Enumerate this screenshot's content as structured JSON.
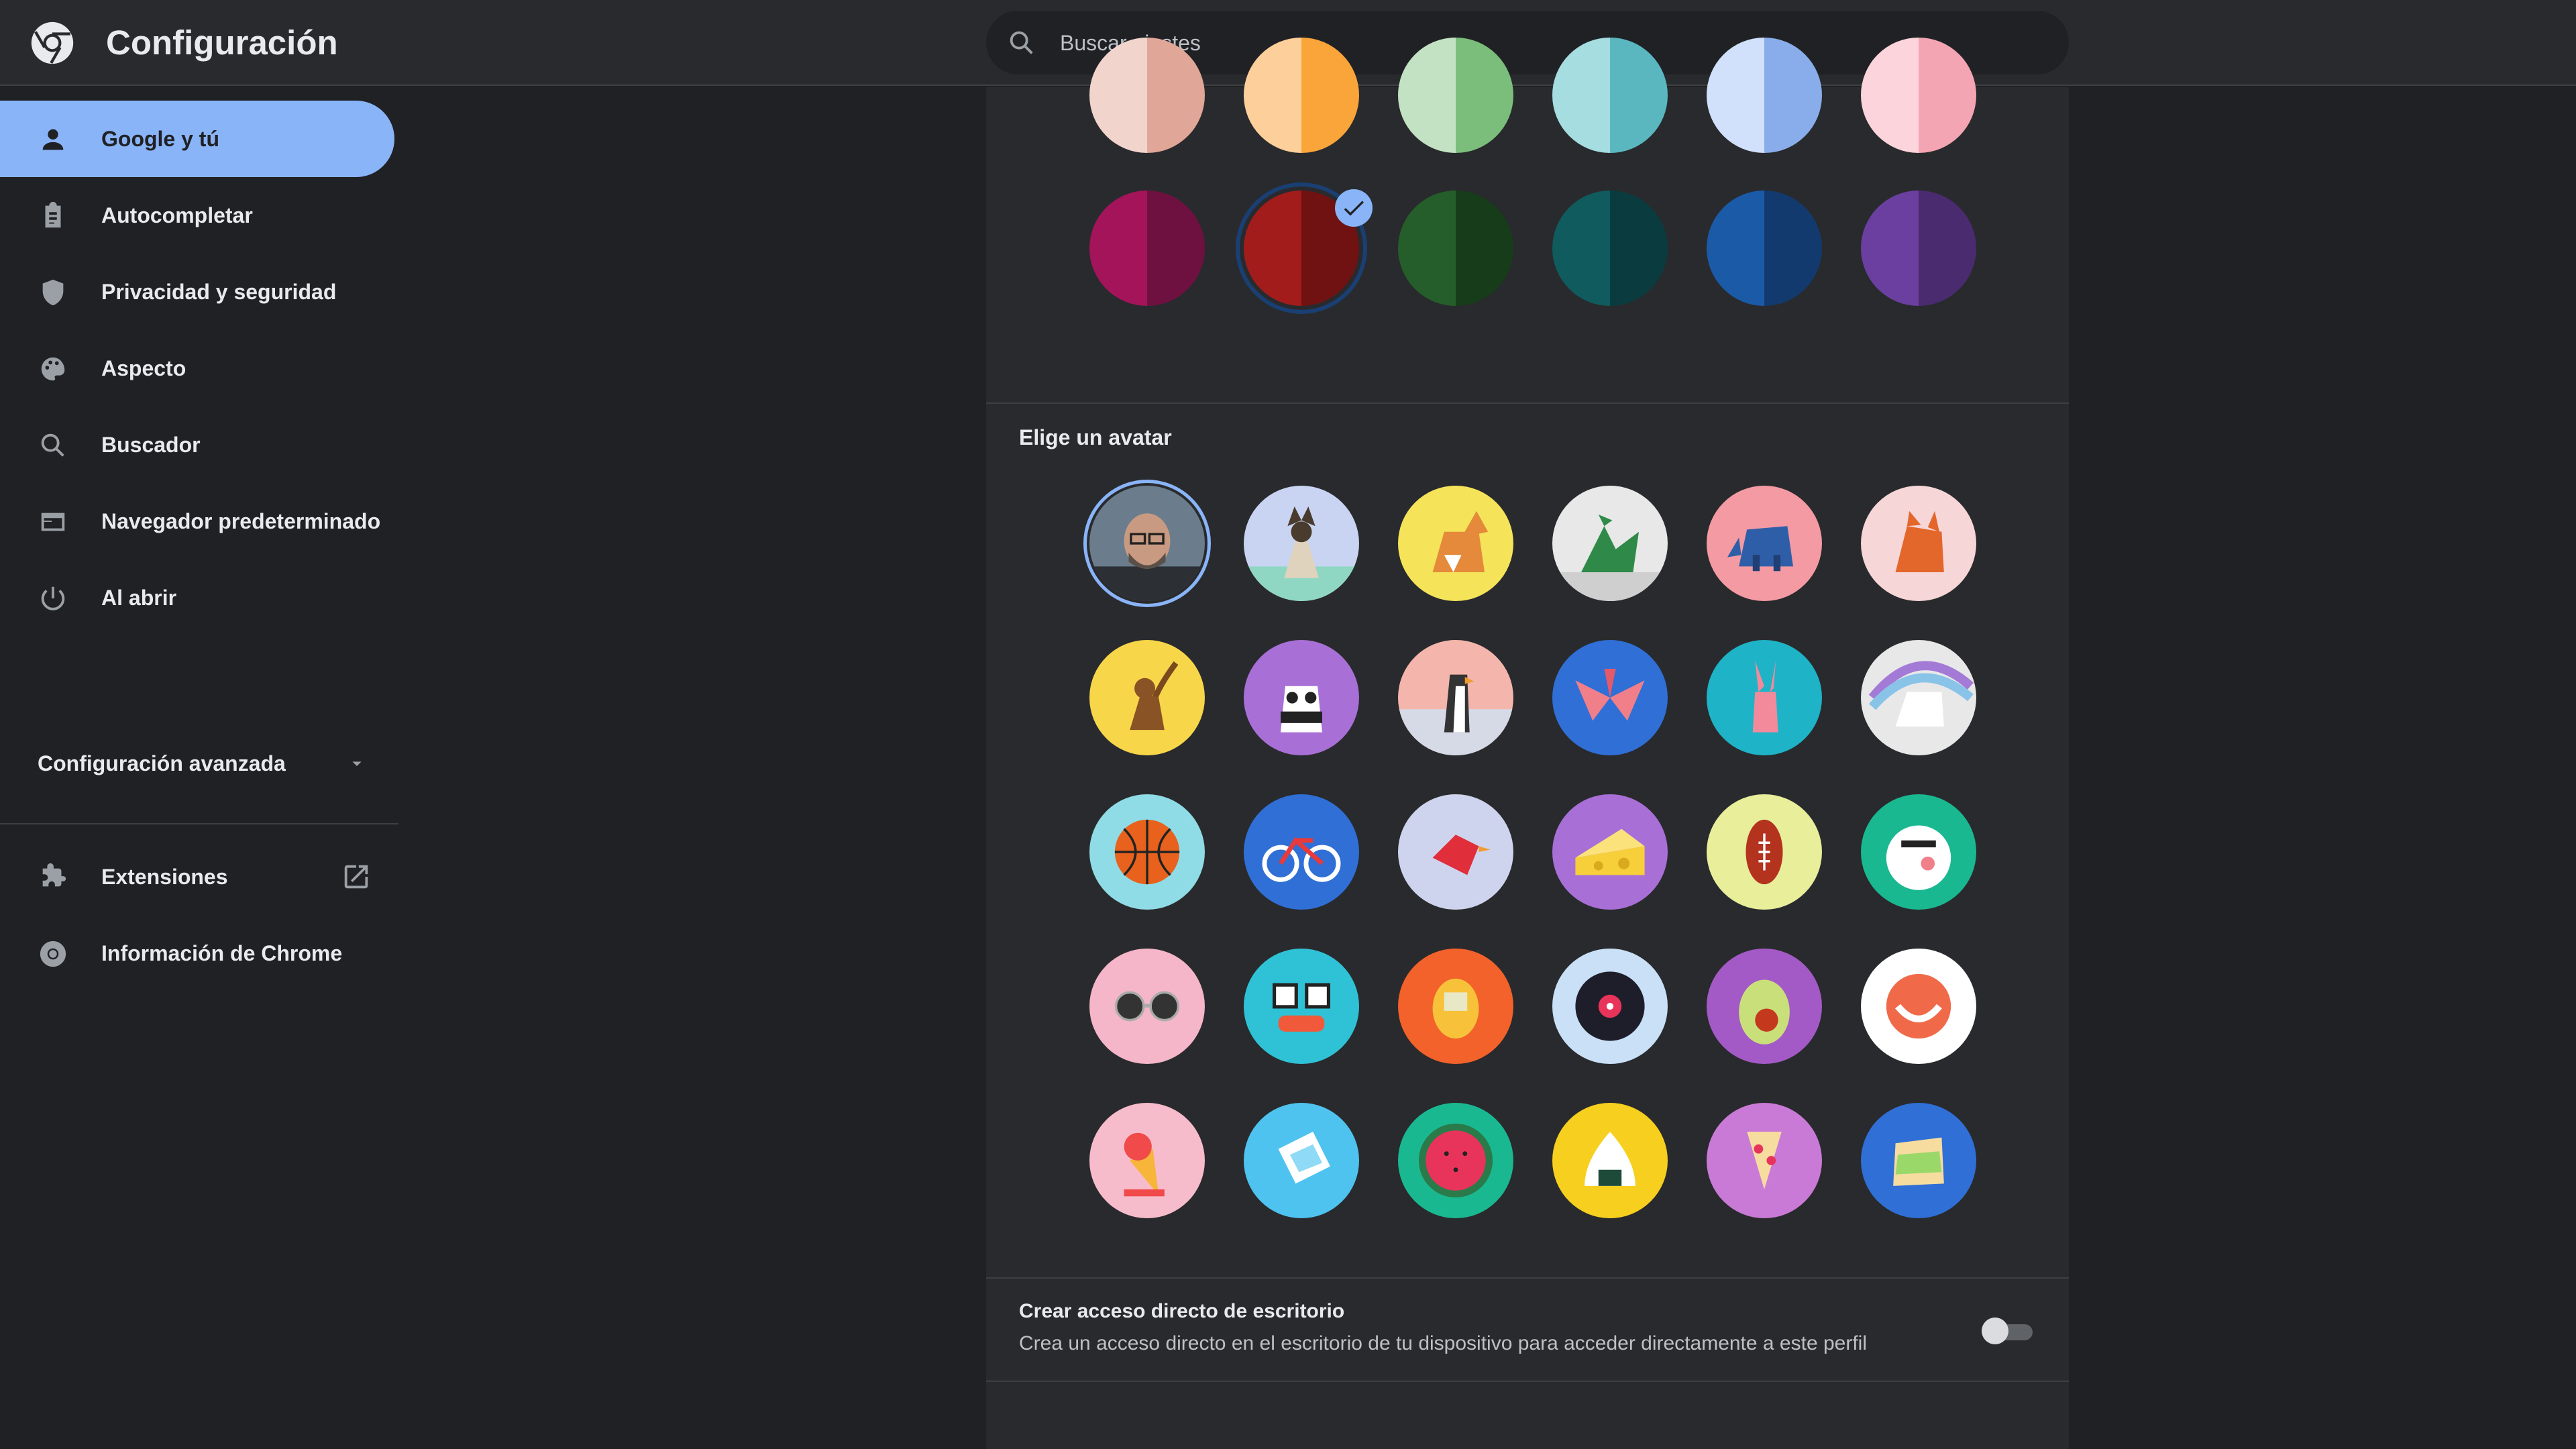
{
  "header": {
    "title": "Configuración",
    "search_placeholder": "Buscar ajustes"
  },
  "sidebar": {
    "items": [
      {
        "label": "Google y tú",
        "icon": "person-icon",
        "active": true
      },
      {
        "label": "Autocompletar",
        "icon": "clipboard-icon"
      },
      {
        "label": "Privacidad y seguridad",
        "icon": "shield-icon"
      },
      {
        "label": "Aspecto",
        "icon": "palette-icon"
      },
      {
        "label": "Buscador",
        "icon": "search-icon"
      },
      {
        "label": "Navegador predeterminado",
        "icon": "browser-window-icon"
      },
      {
        "label": "Al abrir",
        "icon": "power-icon"
      }
    ],
    "advanced_label": "Configuración avanzada",
    "extensions_label": "Extensiones",
    "about_label": "Información de Chrome"
  },
  "theme_colors": {
    "light": [
      {
        "left": "#f1d5cd",
        "right": "#e0a698"
      },
      {
        "left": "#fdcf9a",
        "right": "#f9a53a"
      },
      {
        "left": "#c3e2c3",
        "right": "#7bbe7c"
      },
      {
        "left": "#a5dde1",
        "right": "#5ab7c0"
      },
      {
        "left": "#d1e0fb",
        "right": "#89adea"
      },
      {
        "left": "#fcd4dc",
        "right": "#f4a5b3"
      }
    ],
    "dark": [
      {
        "left": "#a3145a",
        "right": "#6e1140"
      },
      {
        "left": "#a31c1c",
        "right": "#701212"
      },
      {
        "left": "#255e2a",
        "right": "#163c1a"
      },
      {
        "left": "#0f5b5e",
        "right": "#0a3c3f"
      },
      {
        "left": "#1b5aa6",
        "right": "#123a6e"
      },
      {
        "left": "#6b3fa0",
        "right": "#4a2b70"
      }
    ],
    "selected_index": 1
  },
  "avatar_section": {
    "title": "Elige un avatar",
    "avatars": [
      "photo-avatar",
      "cat-avatar",
      "corgi-avatar",
      "dragon-avatar",
      "elephant-avatar",
      "fox-avatar",
      "monkey-avatar",
      "panda-avatar",
      "penguin-avatar",
      "butterfly-avatar",
      "rabbit-avatar",
      "unicorn-avatar",
      "basketball-avatar",
      "bicycle-avatar",
      "bird-avatar",
      "cheese-avatar",
      "football-avatar",
      "ramen-avatar",
      "sunglasses-avatar",
      "sushi-avatar",
      "tamagotchi-avatar",
      "vinyl-avatar",
      "avocado-avatar",
      "smile-avatar",
      "icecream-avatar",
      "tape-avatar",
      "watermelon-avatar",
      "onigiri-avatar",
      "pizza-avatar",
      "sandwich-avatar"
    ],
    "selected_index": 0
  },
  "shortcut": {
    "title": "Crear acceso directo de escritorio",
    "description": "Crea un acceso directo en el escritorio de tu dispositivo para acceder directamente a este perfil",
    "enabled": false
  },
  "colors": {
    "accent": "#8ab4f8",
    "background": "#202124",
    "surface": "#292a2d"
  }
}
